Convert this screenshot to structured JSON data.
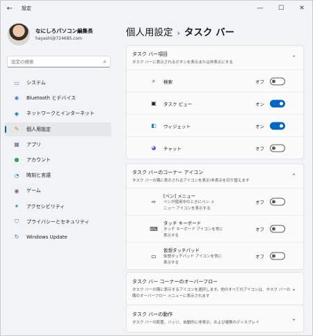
{
  "window": {
    "title": "設定",
    "back_glyph": "←",
    "minimize_glyph": "—",
    "maximize_glyph": "☐",
    "close_glyph": "✕"
  },
  "profile": {
    "name": "なにしろパソコン編集長",
    "email": "hayashi@724685.com"
  },
  "search": {
    "placeholder": "設定の検索",
    "icon": "⌕"
  },
  "nav": [
    {
      "label": "システム",
      "icon": "▭",
      "color": "#3a7bd5"
    },
    {
      "label": "Bluetooth とデバイス",
      "icon": "✱",
      "color": "#3a7bd5"
    },
    {
      "label": "ネットワークとインターネット",
      "icon": "◆",
      "color": "#2a8fd8"
    },
    {
      "label": "個人用設定",
      "icon": "✎",
      "color": "#d07a30"
    },
    {
      "label": "アプリ",
      "icon": "▦",
      "color": "#5b6b85"
    },
    {
      "label": "アカウント",
      "icon": "●",
      "color": "#2aa35a"
    },
    {
      "label": "時刻と言語",
      "icon": "◔",
      "color": "#2a8fd8"
    },
    {
      "label": "ゲーム",
      "icon": "◉",
      "color": "#6b7280"
    },
    {
      "label": "アクセシビリティ",
      "icon": "✦",
      "color": "#2a7bd5"
    },
    {
      "label": "プライバシーとセキュリティ",
      "icon": "⛉",
      "color": "#6b7280"
    },
    {
      "label": "Windows Update",
      "icon": "↻",
      "color": "#2a7bd5"
    }
  ],
  "breadcrumb": {
    "parent": "個人用設定",
    "separator": "›",
    "current": "タスク バー"
  },
  "taskbar_items": {
    "title": "タスク バー項目",
    "desc": "タスク バーに表示されるボタンを表示または非表示にする",
    "chevron": "⌃",
    "rows": [
      {
        "label": "検索",
        "icon": "⌕",
        "state": "オフ",
        "on": false
      },
      {
        "label": "タスク ビュー",
        "icon": "▣",
        "state": "オン",
        "on": true
      },
      {
        "label": "ウィジェット",
        "icon": "◧",
        "state": "オン",
        "on": true
      },
      {
        "label": "チャット",
        "icon": "◕",
        "state": "オフ",
        "on": false
      }
    ]
  },
  "corner_icons": {
    "title": "タスク バーのコーナー アイコン",
    "desc": "タスク バーの隅に表示されるアイコンを表示/非表示を切り替えます",
    "chevron": "⌃",
    "rows": [
      {
        "label": "[ペン] メニュー",
        "sub1": "ペンが使用中のときにペン メ",
        "sub2": "ニュー アイコンを表示する",
        "icon": "✑",
        "state": "オフ",
        "on": false
      },
      {
        "label": "タッチ キーボード",
        "sub1": "タッチ キーボード アイコンを常に",
        "sub2": "表示する",
        "icon": "⌨",
        "state": "オフ",
        "on": false
      },
      {
        "label": "仮想タッチパッド",
        "sub1": "仮想タッチパッド アイコンを常に",
        "sub2": "表示する",
        "icon": "▭",
        "state": "オフ",
        "on": false
      }
    ]
  },
  "overflow": {
    "title": "タスク バー コーナーのオーバーフロー",
    "desc1": "タスク バーの隅に表示するアイコンを選択します。他のすべてのアイコンは、タスク バーの",
    "desc2": "隅のオーバーフロー メニューに表示されます",
    "chevron": "⌄"
  },
  "behavior": {
    "title": "タスク バーの動作",
    "desc": "タスク バーの配置、バッジ、自動的に非表示、および複数のディスプレイ",
    "chevron": "⌄"
  },
  "colors": {
    "accent": "#0067c0"
  }
}
